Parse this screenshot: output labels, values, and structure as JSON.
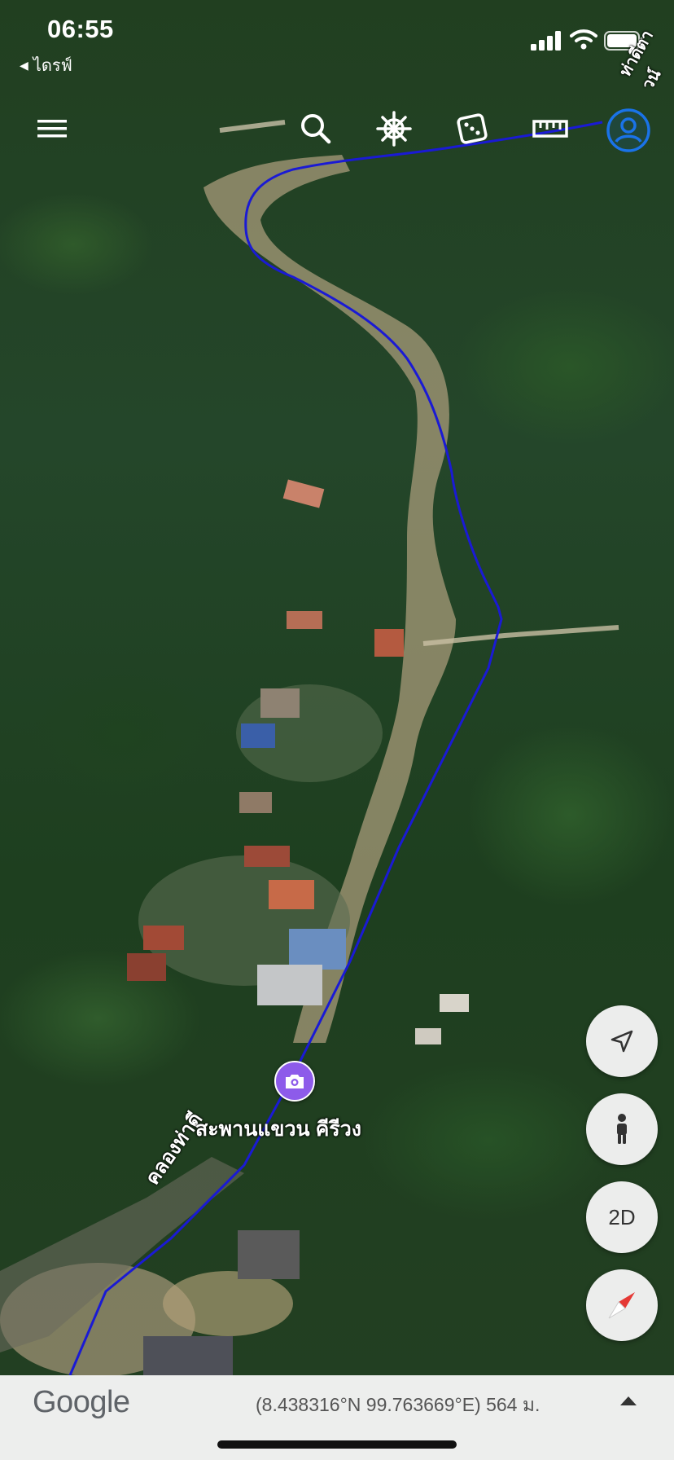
{
  "status_bar": {
    "time": "06:55",
    "back_label": "ไดรฟ์"
  },
  "toolbar": {
    "icons": [
      "menu-icon",
      "search-icon",
      "voyager-icon",
      "dice-icon",
      "ruler-icon",
      "account-icon"
    ]
  },
  "map": {
    "road_label_top": "ท่าดีตาวน์",
    "road_label_bottom": "คลองท่าดี",
    "poi_label": "สะพานแขวน คีรีวง",
    "route_color": "#1a1ad4"
  },
  "controls": {
    "location_icon": "navigation-arrow-icon",
    "streetview_icon": "pegman-icon",
    "view_mode": "2D",
    "compass_icon": "compass-icon"
  },
  "bottom_bar": {
    "logo": "Google",
    "coordinates": "(8.438316°N 99.763669°E) 564 ม."
  },
  "colors": {
    "accent": "#1a73e8",
    "poi": "#8d5bea",
    "compass_red": "#e53935"
  }
}
